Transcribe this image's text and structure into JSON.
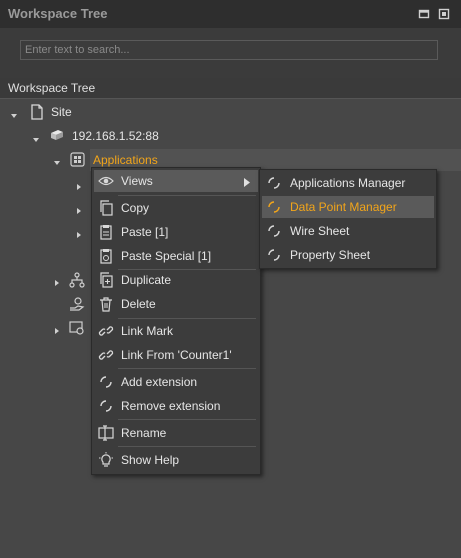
{
  "panel": {
    "title": "Workspace Tree"
  },
  "search": {
    "placeholder": "Enter text to search..."
  },
  "tree_header": "Workspace Tree",
  "tree": {
    "site": "Site",
    "host": "192.168.1.52:88",
    "applications": "Applications"
  },
  "context_menu": {
    "items": [
      {
        "label": "Views",
        "icon": "eye-icon",
        "submenu": true
      },
      {
        "label": "Copy",
        "icon": "copy-icon"
      },
      {
        "label": "Paste [1]",
        "icon": "paste-icon"
      },
      {
        "label": "Paste Special [1]",
        "icon": "paste-special-icon"
      },
      {
        "label": "Duplicate",
        "icon": "duplicate-icon"
      },
      {
        "label": "Delete",
        "icon": "trash-icon"
      },
      {
        "label": "Link Mark",
        "icon": "link-icon"
      },
      {
        "label": "Link From 'Counter1'",
        "icon": "link-icon"
      },
      {
        "label": "Add extension",
        "icon": "spinner-icon"
      },
      {
        "label": "Remove extension",
        "icon": "spinner-icon"
      },
      {
        "label": "Rename",
        "icon": "rename-icon"
      },
      {
        "label": "Show Help",
        "icon": "bulb-icon"
      }
    ]
  },
  "views_submenu": {
    "items": [
      {
        "label": "Applications Manager"
      },
      {
        "label": "Data Point Manager",
        "highlighted": true
      },
      {
        "label": "Wire Sheet"
      },
      {
        "label": "Property Sheet"
      }
    ]
  },
  "colors": {
    "accent": "#f2a51a",
    "background": "#474747"
  }
}
